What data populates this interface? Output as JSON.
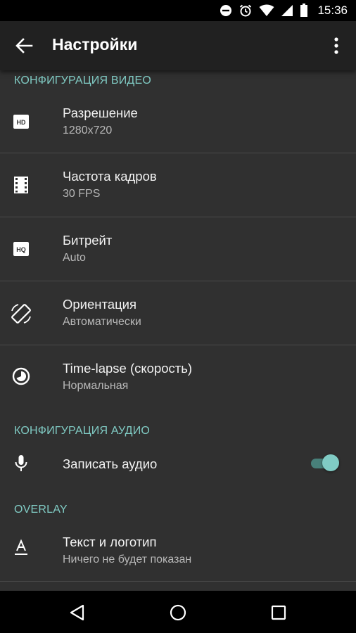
{
  "status_bar": {
    "time": "15:36",
    "icons": [
      "do-not-disturb-icon",
      "alarm-icon",
      "wifi-icon",
      "signal-icon",
      "battery-icon"
    ]
  },
  "app_bar": {
    "title": "Настройки",
    "back_icon": "arrow-back-icon",
    "menu_icon": "more-vert-icon"
  },
  "sections": {
    "video": {
      "header": "КОНФИГУРАЦИЯ ВИДЕО",
      "items": [
        {
          "title": "Разрешение",
          "value": "1280x720",
          "icon": "hd-icon"
        },
        {
          "title": "Частота кадров",
          "value": "30 FPS",
          "icon": "film-icon"
        },
        {
          "title": "Битрейт",
          "value": "Auto",
          "icon": "hq-icon"
        },
        {
          "title": "Ориентация",
          "value": "Автоматически",
          "icon": "screen-rotation-icon"
        },
        {
          "title": "Time-lapse (скорость)",
          "value": "Нормальная",
          "icon": "timelapse-icon"
        }
      ]
    },
    "audio": {
      "header": "КОНФИГУРАЦИЯ АУДИО",
      "items": [
        {
          "title": "Записать аудио",
          "icon": "mic-icon",
          "toggle_on": true
        }
      ]
    },
    "overlay": {
      "header": "OVERLAY",
      "items": [
        {
          "title": "Текст и логотип",
          "value": "Ничего не будет показан",
          "icon": "text-format-icon"
        }
      ]
    }
  },
  "colors": {
    "accent": "#80cbc4",
    "background": "#303030",
    "app_bar": "#212121"
  }
}
